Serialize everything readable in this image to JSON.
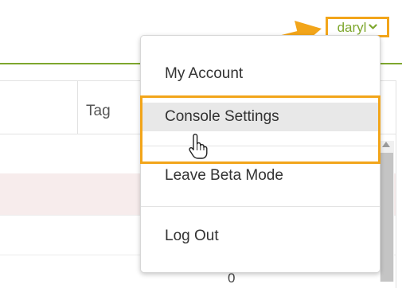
{
  "header": {
    "user_menu_label": "daryl",
    "user_menu_icon": "chevron-down-icon",
    "accent_color": "#7ea72e",
    "annotation_color": "#f2a51a"
  },
  "table": {
    "columns": [
      "Tag"
    ],
    "partial_cell": "0"
  },
  "user_menu": {
    "items": [
      {
        "label": "My Account"
      },
      {
        "label": "Console Settings",
        "hovered": true
      },
      {
        "label": "Leave Beta Mode"
      },
      {
        "label": "Log Out"
      }
    ]
  },
  "annotations": {
    "arrow_icon": "arrow-icon",
    "cursor_icon": "hand-pointer-icon"
  }
}
